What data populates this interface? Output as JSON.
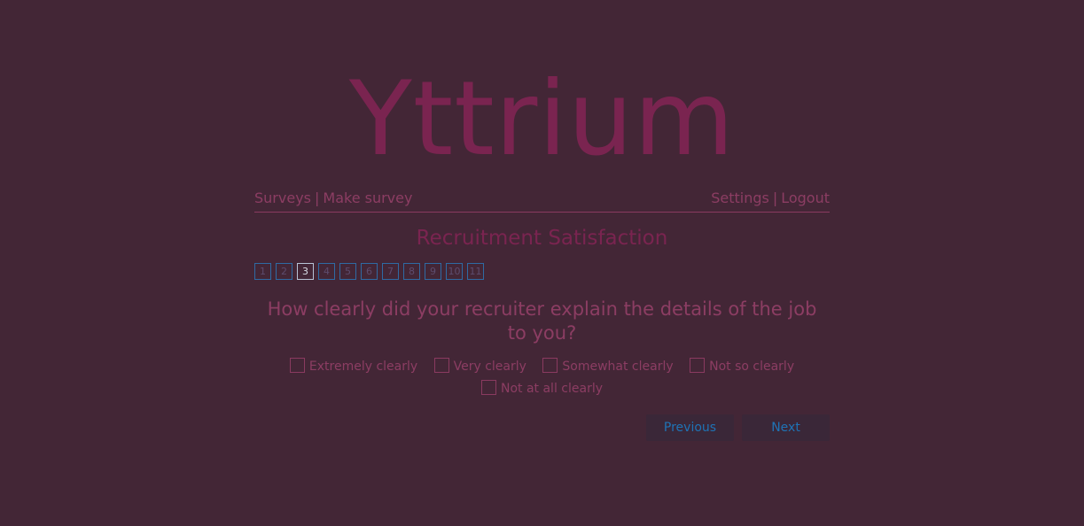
{
  "app": {
    "logo": "Yttrium"
  },
  "nav": {
    "surveys": "Surveys",
    "separator": "|",
    "make_survey": "Make survey",
    "settings": "Settings",
    "logout": "Logout"
  },
  "survey": {
    "title": "Recruitment Satisfaction",
    "pages": [
      "1",
      "2",
      "3",
      "4",
      "5",
      "6",
      "7",
      "8",
      "9",
      "10",
      "11"
    ],
    "current_page": 3,
    "question": "How clearly did your recruiter explain the details of the job to you?",
    "options": [
      {
        "label": "Extremely clearly",
        "checked": false
      },
      {
        "label": "Very clearly",
        "checked": false
      },
      {
        "label": "Somewhat clearly",
        "checked": false
      },
      {
        "label": "Not so clearly",
        "checked": false
      },
      {
        "label": "Not at all clearly",
        "checked": false
      }
    ]
  },
  "buttons": {
    "previous": "Previous",
    "next": "Next"
  },
  "colors": {
    "background": "#432636",
    "accent": "#7a2450",
    "text": "#8c3d63",
    "link_blue": "#1f73b5"
  }
}
